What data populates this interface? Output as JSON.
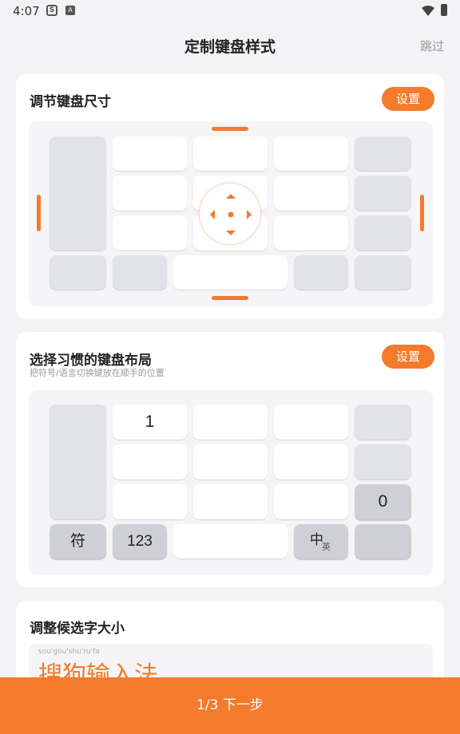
{
  "status": {
    "time": "4:07",
    "icon1": "S",
    "icon2": "A"
  },
  "header": {
    "title": "定制键盘样式",
    "skip": "跳过"
  },
  "size_card": {
    "title": "调节键盘尺寸",
    "button": "设置"
  },
  "layout_card": {
    "title": "选择习惯的键盘布局",
    "subtitle": "把符号/语言切换键放在顺手的位置",
    "button": "设置",
    "keys": {
      "one": "1",
      "zero": "0",
      "symbol": "符",
      "num": "123",
      "lang_zh": "中",
      "lang_en": "英"
    }
  },
  "font_card": {
    "title": "调整候选字大小",
    "pinyin": "sou'gou'shu'ru'fa",
    "preview": "搜狗输入法"
  },
  "footer": {
    "next": "1/3 下一步"
  },
  "colors": {
    "accent": "#f47a2c"
  }
}
